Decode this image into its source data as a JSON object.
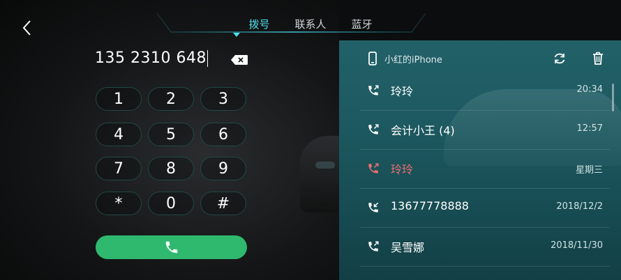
{
  "tabs": [
    {
      "label": "拨号",
      "active": true
    },
    {
      "label": "联系人",
      "active": false
    },
    {
      "label": "蓝牙",
      "active": false
    }
  ],
  "dialer": {
    "number": "135 2310 648",
    "keys": [
      "1",
      "2",
      "3",
      "4",
      "5",
      "6",
      "7",
      "8",
      "9",
      "*",
      "0",
      "#"
    ]
  },
  "device": {
    "name": "小红的iPhone"
  },
  "call_log": [
    {
      "name": "玲玲",
      "time": "20:34",
      "type": "outgoing"
    },
    {
      "name": "会计小王 (4)",
      "time": "12:57",
      "type": "outgoing"
    },
    {
      "name": "玲玲",
      "time": "星期三",
      "type": "missed"
    },
    {
      "name": "13677778888",
      "time": "2018/12/2",
      "type": "incoming"
    },
    {
      "name": "吴雪娜",
      "time": "2018/11/30",
      "type": "outgoing"
    }
  ],
  "colors": {
    "accent": "#4fe0f0",
    "call_green": "#2fb96f",
    "missed_red": "#ee6f6f",
    "panel_teal": "#1d5960"
  }
}
